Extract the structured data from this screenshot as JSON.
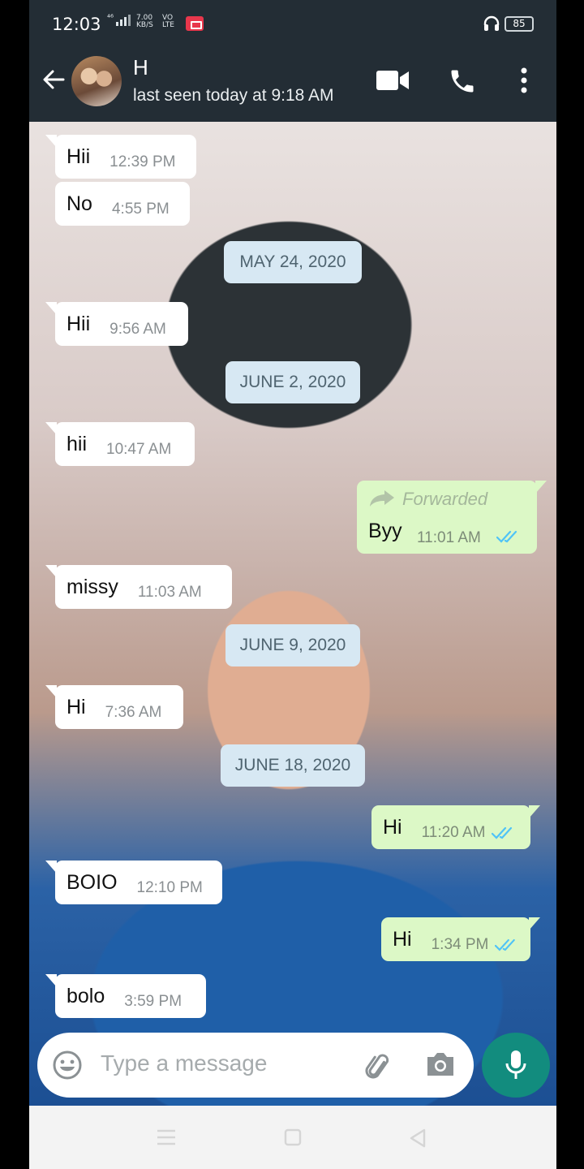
{
  "status_bar": {
    "time": "12:03",
    "network": "⁴⁶",
    "speed_value": "7.00",
    "speed_unit": "KB/S",
    "volte_top": "VO",
    "volte_bottom": "LTE",
    "battery": "85"
  },
  "header": {
    "contact_name": "H",
    "last_seen": "last seen today at 9:18 AM"
  },
  "messages": [
    {
      "dir": "in",
      "text": "Hii",
      "time": "12:39 PM"
    },
    {
      "dir": "in",
      "text": "No",
      "time": "4:55 PM"
    },
    {
      "date": "MAY 24, 2020"
    },
    {
      "dir": "in",
      "text": "Hii",
      "time": "9:56 AM"
    },
    {
      "date": "JUNE 2, 2020"
    },
    {
      "dir": "in",
      "text": "hii",
      "time": "10:47 AM"
    },
    {
      "dir": "out",
      "forwarded_label": "Forwarded",
      "text": "Byy",
      "time": "11:01 AM"
    },
    {
      "dir": "in",
      "text": "missy",
      "time": "11:03 AM"
    },
    {
      "date": "JUNE 9, 2020"
    },
    {
      "dir": "in",
      "text": "Hi",
      "time": "7:36 AM"
    },
    {
      "date": "JUNE 18, 2020"
    },
    {
      "dir": "out",
      "text": "Hi",
      "time": "11:20 AM"
    },
    {
      "dir": "in",
      "text": "BOIO",
      "time": "12:10 PM"
    },
    {
      "dir": "out",
      "text": "Hi",
      "time": "1:34 PM"
    },
    {
      "dir": "in",
      "text": "bolo",
      "time": "3:59 PM"
    }
  ],
  "composer": {
    "placeholder": "Type a message"
  },
  "colors": {
    "header_bg": "#232d35",
    "incoming_bubble": "#ffffff",
    "outgoing_bubble": "#dcf8c6",
    "date_chip": "#d7e8f3",
    "read_ticks": "#4fc3f7",
    "mic_button": "#128c7e"
  },
  "icons": [
    "back-arrow-icon",
    "video-call-icon",
    "phone-icon",
    "more-vert-icon",
    "emoji-icon",
    "attach-icon",
    "camera-icon",
    "mic-icon",
    "forward-icon",
    "double-tick-icon",
    "headset-icon",
    "record-icon"
  ]
}
